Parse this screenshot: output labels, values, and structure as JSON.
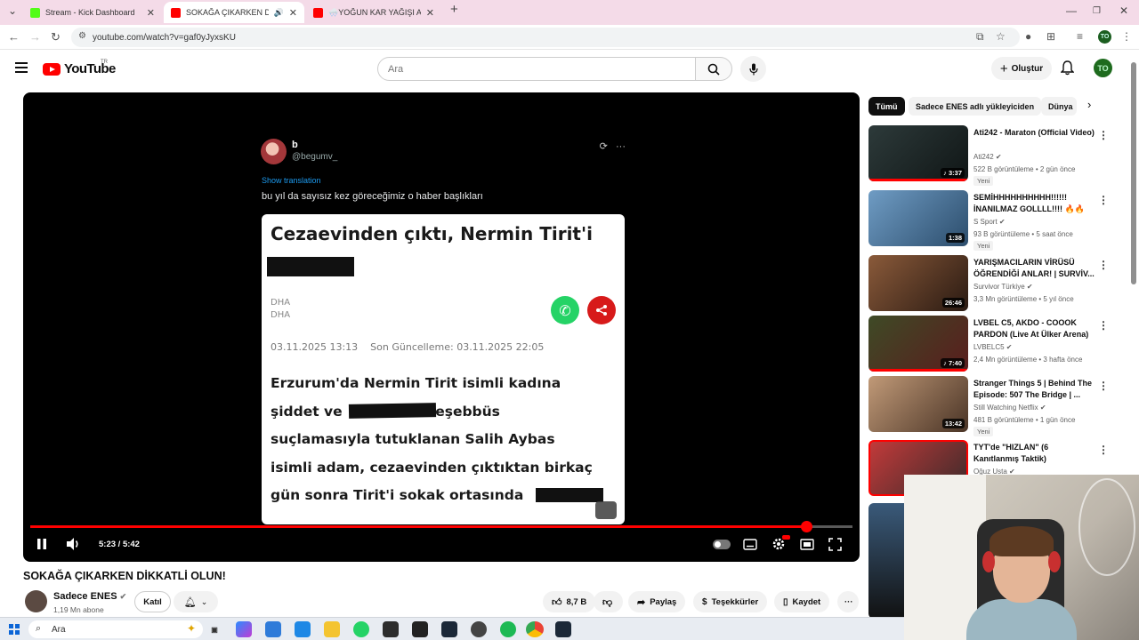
{
  "browser": {
    "tabs": [
      {
        "title": "Stream - Kick Dashboard",
        "favicon": "kick-icon",
        "color": "#53fc18",
        "active": false
      },
      {
        "title": "SOKAĞA ÇIKARKEN DİKKATLİ OLUN!",
        "favicon": "youtube-icon",
        "color": "#ff0000",
        "active": true
      },
      {
        "title": "🌨️YOĞUN KAR YAĞIŞI ALTINDA",
        "favicon": "youtube-icon",
        "color": "#ff0000",
        "active": false
      }
    ],
    "url": "youtube.com/watch?v=gaf0yJyxsKU",
    "profile_initials": "TO"
  },
  "youtube": {
    "logo_text": "YouTube",
    "logo_region": "TR",
    "search_placeholder": "Ara",
    "create_label": "Oluştur",
    "avatar_initials": "TO"
  },
  "player": {
    "tweet": {
      "name": "b",
      "handle": "@begumv_",
      "show_translation": "Show translation",
      "text": "bu yıl da sayısız kez göreceğimiz o haber başlıkları"
    },
    "news": {
      "headline": "Cezaevinden çıktı, Nermin Tirit'i",
      "source1": "DHA",
      "source2": "DHA",
      "date_line": "03.11.2025 13:13    Son Güncelleme: 03.11.2025 22:05",
      "body_lines": [
        "Erzurum'da Nermin Tirit isimli kadına",
        "şiddet ve                  teşebbüs",
        "suçlamasıyla tutuklanan Salih Aybas",
        "isimli adam, cezaevinden çıktıktan birkaç",
        "gün sonra Tirit'i sokak ortasında"
      ]
    },
    "time_current": "5:23",
    "time_separator": "/",
    "time_total": "5:42",
    "progress_fraction": 0.944,
    "accent_color": "#ff0000"
  },
  "video": {
    "title": "SOKAĞA ÇIKARKEN DİKKATLİ OLUN!",
    "channel": "Sadece ENES",
    "subscribers": "1,19 Mn abone",
    "join_label": "Katıl",
    "likes": "8,7 B",
    "share_label": "Paylaş",
    "thanks_label": "Teşekkürler",
    "save_label": "Kaydet"
  },
  "chips": [
    "Tümü",
    "Sadece ENES adlı yükleyiciden",
    "Dünya"
  ],
  "recommendations": [
    {
      "title": "Ati242 - Maraton (Official Video)",
      "channel": "Ati242",
      "meta": "522 B görüntüleme • 2 gün önce",
      "duration": "♪ 3:37",
      "badge": "Yeni",
      "watched": 1.0,
      "thumb_color": "#1f2a2a"
    },
    {
      "title": "SEMİHHHHHHHHHH!!!!!! İNANILMAZ GOLLLL!!!! 🔥🔥🔥",
      "channel": "S Sport",
      "meta": "93 B görüntüleme • 5 saat önce",
      "duration": "1:38",
      "badge": "Yeni",
      "watched": 0,
      "thumb_color": "#4d7fa8"
    },
    {
      "title": "YARIŞMACILARIN VİRÜSÜ ÖĞRENDİĞİ ANLAR! | SURVİV...",
      "channel": "Survivor Türkiye",
      "meta": "3,3 Mn görüntüleme • 5 yıl önce",
      "duration": "26:46",
      "badge": "",
      "watched": 0,
      "thumb_color": "#6a3d2a"
    },
    {
      "title": "LVBEL C5, AKDO - COOOK PARDON (Live At Ülker Arena)",
      "channel": "LVBELC5",
      "meta": "2,4 Mn görüntüleme • 3 hafta önce",
      "duration": "♪ 7:40",
      "badge": "",
      "watched": 1.0,
      "thumb_color": "#2f3a22"
    },
    {
      "title": "Stranger Things 5 | Behind The Episode: 507 The Bridge | ...",
      "channel": "Still Watching Netflix",
      "meta": "481 B görüntüleme • 1 gün önce",
      "duration": "13:42",
      "badge": "Yeni",
      "watched": 0,
      "thumb_color": "#9a7658"
    },
    {
      "title": "TYT'de \"HIZLAN\" (6 Kanıtlanmış Taktik)",
      "channel": "Oğuz Usta",
      "meta": "",
      "duration": "",
      "badge": "",
      "watched": 0,
      "thumb_color": "#b83232"
    }
  ],
  "taskbar": {
    "search_placeholder": "Ara"
  }
}
